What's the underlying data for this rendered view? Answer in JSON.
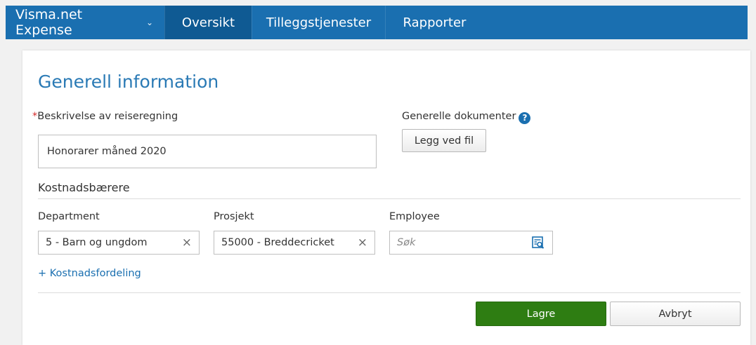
{
  "header": {
    "app_title": "Visma.net Expense",
    "nav": [
      {
        "label": "Oversikt",
        "active": true
      },
      {
        "label": "Tilleggstjenester",
        "active": false
      },
      {
        "label": "Rapporter",
        "active": false
      }
    ]
  },
  "form": {
    "title": "Generell information",
    "description_label": "Beskrivelse av reiseregning",
    "required_marker": "*",
    "description_value": "Honorarer måned 2020",
    "documents_label": "Generelle dokumenter",
    "help_glyph": "?",
    "attach_button": "Legg ved fil",
    "cost_carriers_title": "Kostnadsbærere",
    "department_label": "Department",
    "department_value": "5 - Barn og ungdom",
    "project_label": "Prosjekt",
    "project_value": "55000 - Breddecricket",
    "employee_label": "Employee",
    "employee_placeholder": "Søk",
    "clear_glyph": "×",
    "cost_distribution_link": "+ Kostnadsfordeling",
    "save_button": "Lagre",
    "cancel_button": "Avbryt"
  },
  "colors": {
    "topbar": "#1a6fb0",
    "active_tab": "#0f5a93",
    "title": "#2a7ab5",
    "save": "#2e7d12"
  },
  "icons": [
    "chevron-down-icon",
    "help-icon",
    "clear-icon",
    "search-lookup-icon"
  ]
}
